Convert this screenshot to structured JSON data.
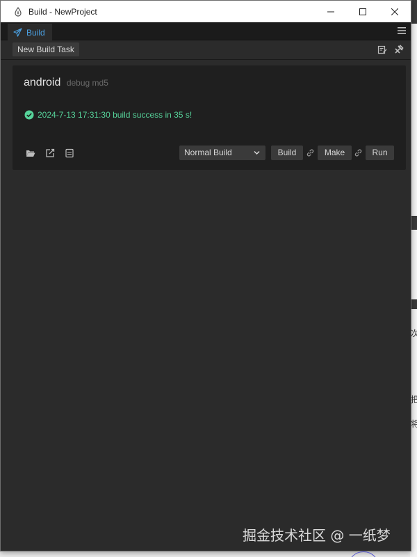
{
  "window": {
    "title": "Build - NewProject"
  },
  "tabs": [
    {
      "label": "Build"
    }
  ],
  "toolbar": {
    "new_task_label": "New Build Task"
  },
  "task": {
    "platform": "android",
    "meta": "debug md5",
    "status_text": "2024-7-13 17:31:30 build success in 35 s!",
    "build_mode": "Normal Build",
    "build_label": "Build",
    "make_label": "Make",
    "run_label": "Run"
  },
  "watermark": "掘金技术社区 @ 一纸梦",
  "colors": {
    "accent": "#4a9fe0",
    "success": "#56d39a",
    "panel": "#2b2b2b",
    "card": "#1f1f1f"
  }
}
